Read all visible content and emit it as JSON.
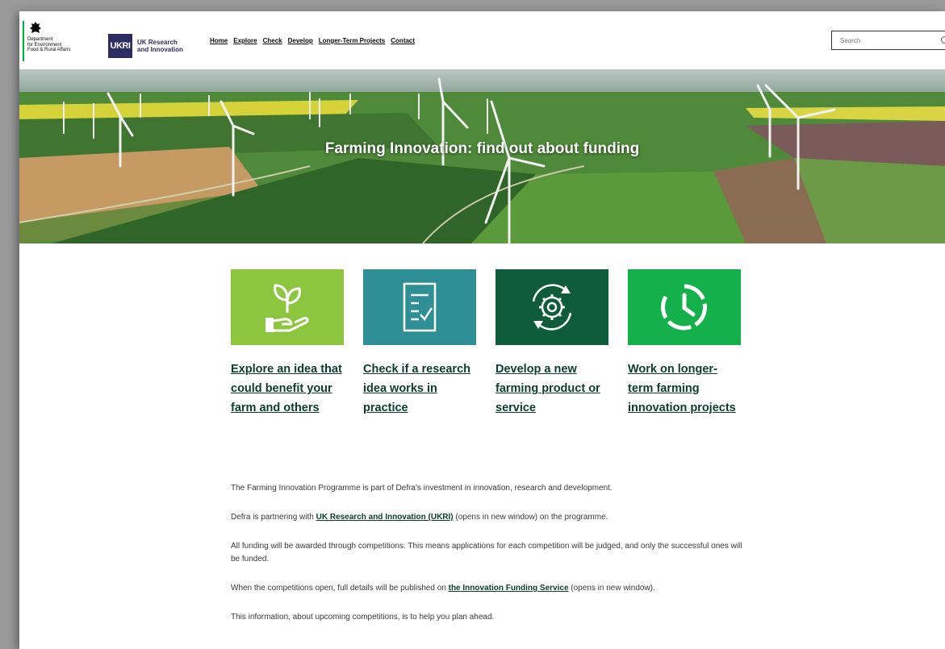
{
  "header": {
    "defra_lines": [
      "Department",
      "for Environment",
      "Food & Rural Affairs"
    ],
    "ukri_logo_text": "UKRI",
    "ukri_lines": [
      "UK Research",
      "and Innovation"
    ],
    "nav": [
      "Home",
      "Explore",
      "Check",
      "Develop",
      "Longer-Term Projects",
      "Contact"
    ],
    "search_placeholder": "Search"
  },
  "hero": {
    "title": "Farming Innovation: find out about funding"
  },
  "cards": [
    {
      "icon": "plant-in-hand-icon",
      "color": "#8cc63f",
      "label": "Explore an idea that could benefit your farm and others"
    },
    {
      "icon": "checklist-icon",
      "color": "#2e8f96",
      "label": "Check if a research idea works in practice"
    },
    {
      "icon": "gear-cycle-icon",
      "color": "#0f5c3a",
      "label": "Develop a new farming product or service"
    },
    {
      "icon": "clock-icon",
      "color": "#13b04b",
      "label": "Work on longer-term farming innovation projects"
    }
  ],
  "info": {
    "p1": "The Farming Innovation Programme is part of Defra's investment in innovation, research and development.",
    "p2_before": "Defra is partnering with ",
    "p2_link": "UK Research and Innovation (UKRI)",
    "p2_after": " (opens in new window) on the programme.",
    "p3": "All funding will be awarded through competitions. This means applications for each competition will be judged, and only the successful ones will be funded.",
    "p4_before": "When the competitions open, full details will be published on ",
    "p4_link": "the Innovation Funding Service",
    "p4_after": " (opens in new window).",
    "p5": "This information, about upcoming competitions, is to help you plan ahead."
  }
}
